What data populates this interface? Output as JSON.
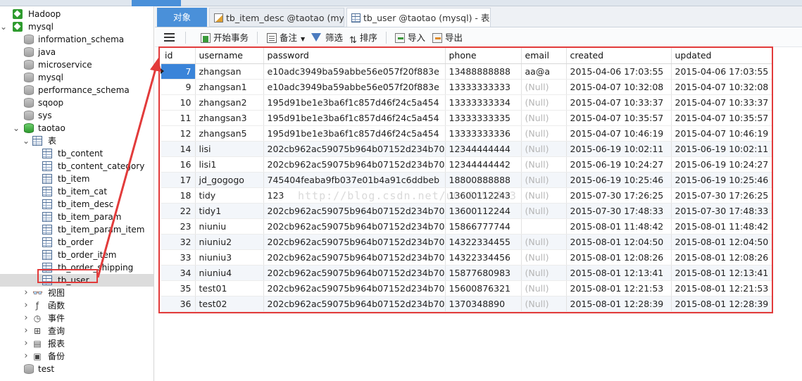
{
  "sidebar": {
    "items": [
      {
        "label": "Hadoop",
        "kind": "conn",
        "depth": 0,
        "arrow": ""
      },
      {
        "label": "mysql",
        "kind": "conn",
        "depth": 0,
        "arrow": "v"
      },
      {
        "label": "information_schema",
        "kind": "db",
        "depth": 1,
        "arrow": ""
      },
      {
        "label": "java",
        "kind": "db",
        "depth": 1,
        "arrow": ""
      },
      {
        "label": "microservice",
        "kind": "db",
        "depth": 1,
        "arrow": ""
      },
      {
        "label": "mysql",
        "kind": "db",
        "depth": 1,
        "arrow": ""
      },
      {
        "label": "performance_schema",
        "kind": "db",
        "depth": 1,
        "arrow": ""
      },
      {
        "label": "sqoop",
        "kind": "db",
        "depth": 1,
        "arrow": ""
      },
      {
        "label": "sys",
        "kind": "db",
        "depth": 1,
        "arrow": ""
      },
      {
        "label": "taotao",
        "kind": "dbgreen",
        "depth": 1,
        "arrow": "v"
      },
      {
        "label": "表",
        "kind": "tablegroup",
        "depth": 2,
        "arrow": "v"
      },
      {
        "label": "tb_content",
        "kind": "table",
        "depth": 3,
        "arrow": ""
      },
      {
        "label": "tb_content_category",
        "kind": "table",
        "depth": 3,
        "arrow": ""
      },
      {
        "label": "tb_item",
        "kind": "table",
        "depth": 3,
        "arrow": ""
      },
      {
        "label": "tb_item_cat",
        "kind": "table",
        "depth": 3,
        "arrow": ""
      },
      {
        "label": "tb_item_desc",
        "kind": "table",
        "depth": 3,
        "arrow": ""
      },
      {
        "label": "tb_item_param",
        "kind": "table",
        "depth": 3,
        "arrow": ""
      },
      {
        "label": "tb_item_param_item",
        "kind": "table",
        "depth": 3,
        "arrow": ""
      },
      {
        "label": "tb_order",
        "kind": "table",
        "depth": 3,
        "arrow": ""
      },
      {
        "label": "tb_order_item",
        "kind": "table",
        "depth": 3,
        "arrow": ""
      },
      {
        "label": "tb_order_shipping",
        "kind": "table",
        "depth": 3,
        "arrow": ""
      },
      {
        "label": "tb_user",
        "kind": "table",
        "depth": 3,
        "arrow": "",
        "selected": true
      },
      {
        "label": "视图",
        "kind": "view",
        "depth": 2,
        "arrow": ">"
      },
      {
        "label": "函数",
        "kind": "func",
        "depth": 2,
        "arrow": ">"
      },
      {
        "label": "事件",
        "kind": "event",
        "depth": 2,
        "arrow": ">"
      },
      {
        "label": "查询",
        "kind": "query",
        "depth": 2,
        "arrow": ">"
      },
      {
        "label": "报表",
        "kind": "report",
        "depth": 2,
        "arrow": ">"
      },
      {
        "label": "备份",
        "kind": "backup",
        "depth": 2,
        "arrow": ">"
      },
      {
        "label": "test",
        "kind": "db",
        "depth": 1,
        "arrow": ""
      }
    ]
  },
  "tabs": {
    "objects": "对象",
    "tab2": "tb_item_desc @taotao (mys...",
    "tab3": "tb_user @taotao (mysql) - 表"
  },
  "toolbar": {
    "begin_tx": "开始事务",
    "note": "备注",
    "filter": "筛选",
    "sort": "排序",
    "import": "导入",
    "export": "导出"
  },
  "grid": {
    "columns": [
      "id",
      "username",
      "password",
      "phone",
      "email",
      "created",
      "updated"
    ],
    "rows": [
      [
        "7",
        "zhangsan",
        "e10adc3949ba59abbe56e057f20f883e",
        "13488888888",
        "aa@a",
        "2015-04-06 17:03:55",
        "2015-04-06 17:03:55"
      ],
      [
        "9",
        "zhangsan1",
        "e10adc3949ba59abbe56e057f20f883e",
        "13333333333",
        "(Null)",
        "2015-04-07 10:32:08",
        "2015-04-07 10:32:08"
      ],
      [
        "10",
        "zhangsan2",
        "195d91be1e3ba6f1c857d46f24c5a454",
        "13333333334",
        "(Null)",
        "2015-04-07 10:33:37",
        "2015-04-07 10:33:37"
      ],
      [
        "11",
        "zhangsan3",
        "195d91be1e3ba6f1c857d46f24c5a454",
        "13333333335",
        "(Null)",
        "2015-04-07 10:35:57",
        "2015-04-07 10:35:57"
      ],
      [
        "12",
        "zhangsan5",
        "195d91be1e3ba6f1c857d46f24c5a454",
        "13333333336",
        "(Null)",
        "2015-04-07 10:46:19",
        "2015-04-07 10:46:19"
      ],
      [
        "14",
        "lisi",
        "202cb962ac59075b964b07152d234b70",
        "12344444444",
        "(Null)",
        "2015-06-19 10:02:11",
        "2015-06-19 10:02:11"
      ],
      [
        "16",
        "lisi1",
        "202cb962ac59075b964b07152d234b70",
        "12344444442",
        "(Null)",
        "2015-06-19 10:24:27",
        "2015-06-19 10:24:27"
      ],
      [
        "17",
        "jd_gogogo",
        "745404feaba9fb037e01b4a91c6ddbeb",
        "18800888888",
        "(Null)",
        "2015-06-19 10:25:46",
        "2015-06-19 10:25:46"
      ],
      [
        "18",
        "tidy",
        "123",
        "13600112243",
        "(Null)",
        "2015-07-30 17:26:25",
        "2015-07-30 17:26:25"
      ],
      [
        "22",
        "tidy1",
        "202cb962ac59075b964b07152d234b70",
        "13600112244",
        "(Null)",
        "2015-07-30 17:48:33",
        "2015-07-30 17:48:33"
      ],
      [
        "23",
        "niuniu",
        "202cb962ac59075b964b07152d234b70",
        "15866777744",
        "",
        "2015-08-01 11:48:42",
        "2015-08-01 11:48:42"
      ],
      [
        "32",
        "niuniu2",
        "202cb962ac59075b964b07152d234b70",
        "14322334455",
        "(Null)",
        "2015-08-01 12:04:50",
        "2015-08-01 12:04:50"
      ],
      [
        "33",
        "niuniu3",
        "202cb962ac59075b964b07152d234b70",
        "14322334456",
        "(Null)",
        "2015-08-01 12:08:26",
        "2015-08-01 12:08:26"
      ],
      [
        "34",
        "niuniu4",
        "202cb962ac59075b964b07152d234b70",
        "15877680983",
        "(Null)",
        "2015-08-01 12:13:41",
        "2015-08-01 12:13:41"
      ],
      [
        "35",
        "test01",
        "202cb962ac59075b964b07152d234b70",
        "15600876321",
        "(Null)",
        "2015-08-01 12:21:53",
        "2015-08-01 12:21:53"
      ],
      [
        "36",
        "test02",
        "202cb962ac59075b964b07152d234b70",
        "1370348890",
        "(Null)",
        "2015-08-01 12:28:39",
        "2015-08-01 12:28:39"
      ]
    ]
  },
  "watermark": "http://blog.csdn.net/u012453843",
  "colors": {
    "accent": "#4a90d9",
    "annotation": "#e23b3b",
    "null_text": "#b5b5b5",
    "selection": "#3a84d9"
  }
}
